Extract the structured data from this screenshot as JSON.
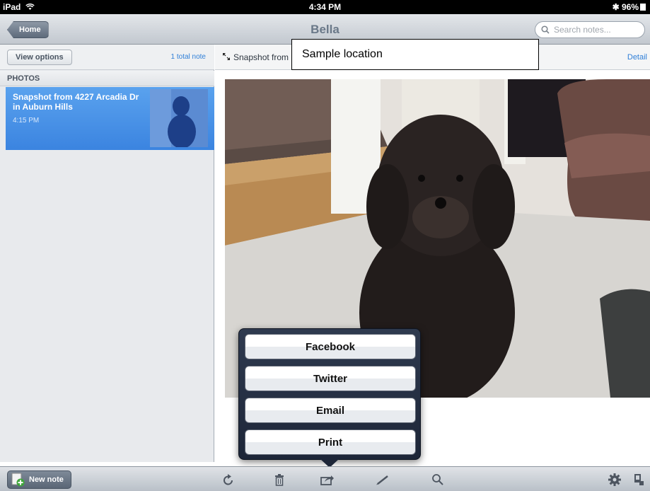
{
  "status_bar": {
    "device": "iPad",
    "time": "4:34 PM",
    "battery": "96%"
  },
  "nav": {
    "back_label": "Home",
    "title": "Bella",
    "search_placeholder": "Search notes..."
  },
  "sidebar": {
    "view_options_label": "View options",
    "total_notes": "1 total note",
    "section_header": "PHOTOS",
    "notes": [
      {
        "title": "Snapshot from 4227 Arcadia Dr in Auburn Hills",
        "time": "4:15 PM"
      }
    ]
  },
  "detail": {
    "title_truncated": "Snapshot from",
    "location_label": "Sample location",
    "detail_link": "Detail"
  },
  "share_popover": {
    "options": [
      "Facebook",
      "Twitter",
      "Email",
      "Print"
    ]
  },
  "toolbar": {
    "new_note_label": "New note",
    "icons": [
      "refresh-icon",
      "trash-icon",
      "share-icon",
      "pen-icon",
      "search-icon",
      "gear-icon",
      "sync-icon"
    ]
  },
  "colors": {
    "selection": "#3b84e0",
    "link": "#2f7fd8",
    "popover": "#1d2638"
  }
}
